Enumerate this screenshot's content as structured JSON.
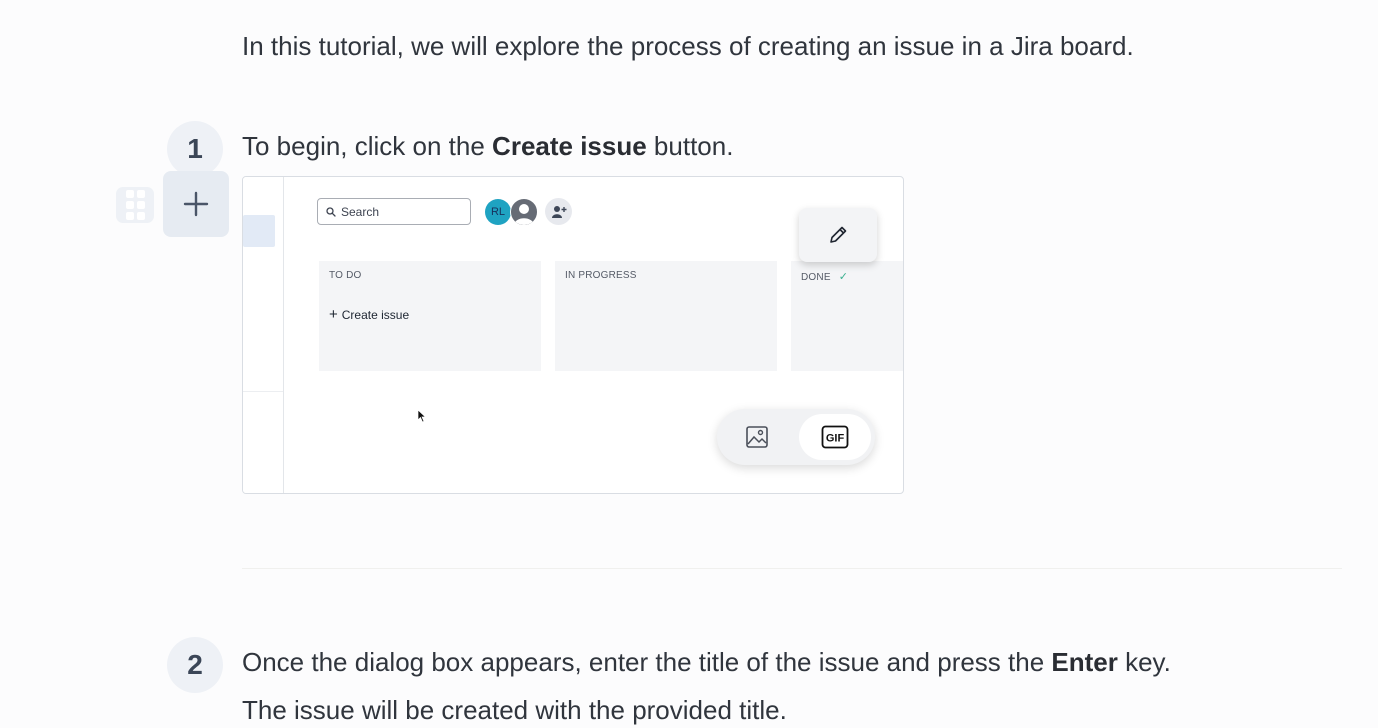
{
  "intro": {
    "text": "In this tutorial, we will explore the process of creating an issue in a Jira board."
  },
  "steps": [
    {
      "number": "1",
      "text_before": "To begin, click on the ",
      "text_bold": "Create issue",
      "text_after": " button."
    },
    {
      "number": "2",
      "text_before": "Once the dialog box appears, enter the title of the issue and press the ",
      "text_bold": "Enter",
      "text_after": " key.",
      "text_line2": "The issue will be created with the provided title."
    }
  ],
  "editor": {
    "drag_handle_icon": "drag-handle-icon",
    "add_block_icon": "plus-icon"
  },
  "screenshot": {
    "search": {
      "placeholder": "Search"
    },
    "avatars": [
      {
        "initials": "RL",
        "color": "#1fa3c2"
      },
      {
        "initials": "",
        "color": "#666b75"
      }
    ],
    "add_people_icon": "add-people-icon",
    "columns": [
      {
        "title": "TO DO",
        "action": "Create issue"
      },
      {
        "title": "IN PROGRESS"
      },
      {
        "title": "DONE",
        "status_icon": "check-icon"
      }
    ],
    "toolbar": {
      "edit_icon": "pencil-icon",
      "image_icon": "image-icon",
      "gif_label": "GIF"
    }
  },
  "colors": {
    "accent": "#1fa3c2",
    "done_check": "#3bb08f",
    "step_badge_bg": "#eef1f6"
  }
}
